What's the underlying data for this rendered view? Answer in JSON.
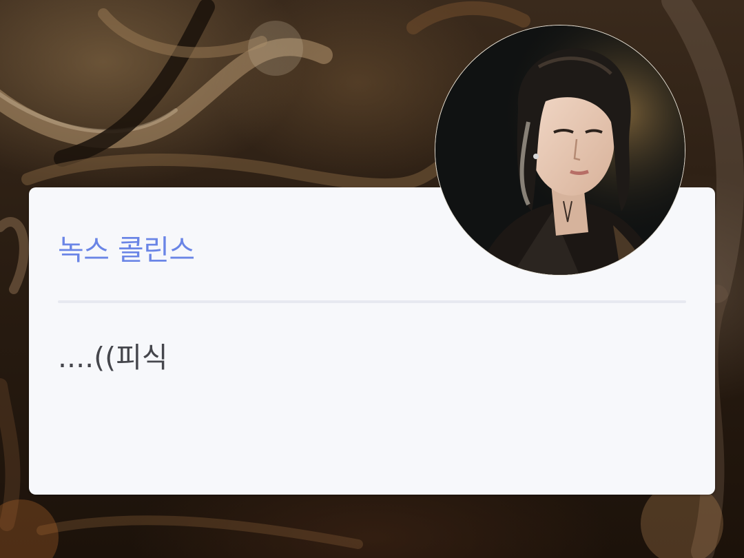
{
  "profile": {
    "name": "녹스 콜린스",
    "message": "....((피식"
  },
  "colors": {
    "name_accent": "#6a85e6",
    "message_text": "#45464c",
    "card_background": "#f7f8fb",
    "divider": "#e7e9f0"
  },
  "icons": {
    "avatar": "portrait-photo",
    "background": "blurred-cables-photo"
  }
}
